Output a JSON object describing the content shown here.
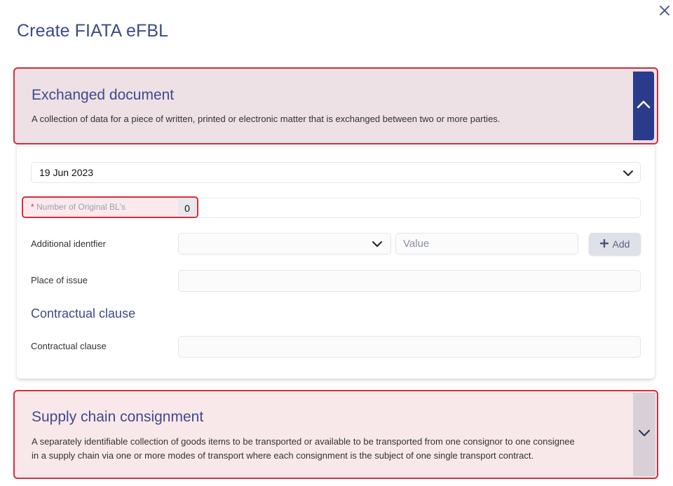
{
  "dialog": {
    "title": "Create FIATA eFBL",
    "close_icon": "close-icon"
  },
  "exchanged_document": {
    "title": "Exchanged document",
    "description": "A collection of data for a piece of written, printed or electronic matter that is exchanged between two or more parties.",
    "toggle_icon": "chevron-up-icon",
    "date_value": "19 Jun 2023",
    "number_of_original_bls": {
      "required_mark": "*",
      "label": "Number of Original BL's",
      "value": "0"
    },
    "additional_identifier": {
      "label": "Additional identfier",
      "type_value": "",
      "value_placeholder": "Value",
      "add_label": "Add"
    },
    "place_of_issue": {
      "label": "Place of issue",
      "value": ""
    },
    "contractual_clause_section": {
      "title": "Contractual clause",
      "label": "Contractual clause",
      "value": ""
    }
  },
  "supply_chain_consignment": {
    "title": "Supply chain consignment",
    "description_line1": "A separately identifiable collection of goods items to be transported or available to be transported from one consignor to one consignee",
    "description_line2": "in a supply chain via one or more modes of transport where each consignment is the subject of one single transport contract.",
    "toggle_icon": "chevron-down-icon"
  },
  "colors": {
    "accent": "#3d4a8e",
    "highlight_border": "#d32f3f",
    "toggle_active": "#2b3b8c"
  }
}
